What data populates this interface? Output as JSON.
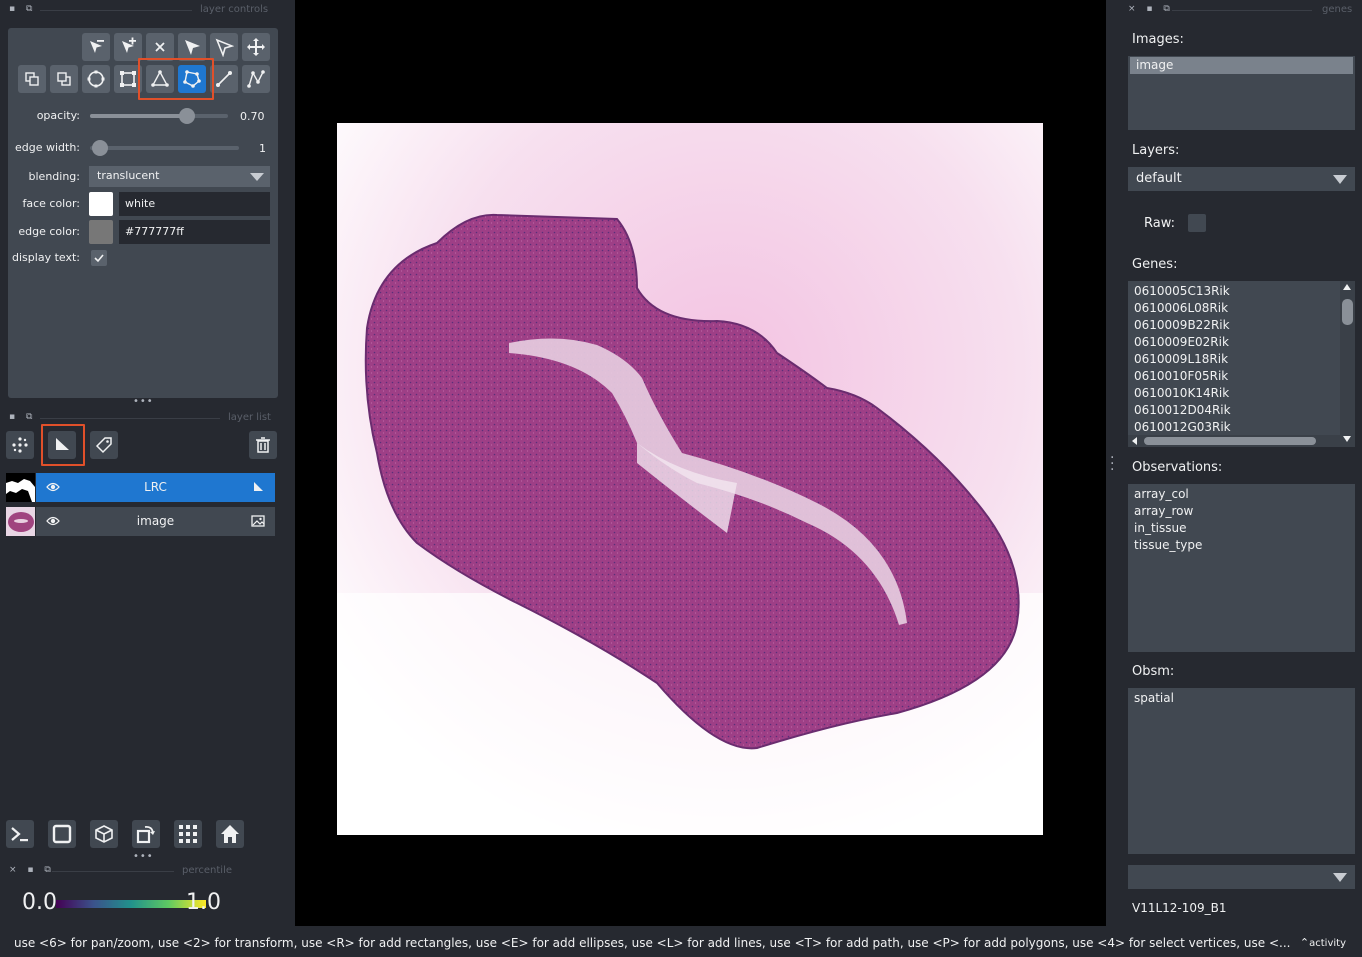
{
  "left_dock": {
    "layer_controls_title": "layer controls",
    "opacity_label": "opacity:",
    "opacity_value": "0.70",
    "opacity_fraction": 0.7,
    "edge_width_label": "edge width:",
    "edge_width_value": "1",
    "blending_label": "blending:",
    "blending_value": "translucent",
    "face_color_label": "face color:",
    "face_color_value": "white",
    "face_color_hex": "#ffffff",
    "edge_color_label": "edge color:",
    "edge_color_value": "#777777ff",
    "edge_color_hex": "#777777",
    "display_text_label": "display text:",
    "display_text_checked": true,
    "layer_list_title": "layer list",
    "layers": [
      {
        "name": "LRC",
        "selected": true,
        "visible": true,
        "type_icon": "shapes-icon"
      },
      {
        "name": "image",
        "selected": false,
        "visible": true,
        "type_icon": "image-icon"
      }
    ],
    "percentile_title": "percentile",
    "colorbar_min": "0.0",
    "colorbar_max": "1.0"
  },
  "right_dock": {
    "title": "genes",
    "images_label": "Images:",
    "images": [
      "image"
    ],
    "layers_label": "Layers:",
    "layers_value": "default",
    "raw_label": "Raw:",
    "genes_label": "Genes:",
    "genes": [
      "0610005C13Rik",
      "0610006L08Rik",
      "0610009B22Rik",
      "0610009E02Rik",
      "0610009L18Rik",
      "0610010F05Rik",
      "0610010K14Rik",
      "0610012D04Rik",
      "0610012G03Rik"
    ],
    "observations_label": "Observations:",
    "observations": [
      "array_col",
      "array_row",
      "in_tissue",
      "tissue_type"
    ],
    "obsm_label": "Obsm:",
    "obsm": [
      "spatial"
    ],
    "dataset_combo_value": "",
    "dataset_name": "V11L12-109_B1"
  },
  "status": {
    "message": "use <6> for pan/zoom, use <2> for transform, use <R> for add rectangles, use <E> for add ellipses, use <L> for add lines, use <T> for add path, use <P> for add polygons, use <4> for select vertices, use <...",
    "activity_label": "activity"
  },
  "colors": {
    "accent": "#1f77d0",
    "highlight_box": "#e0502a",
    "panel": "#414851",
    "background": "#262930"
  }
}
